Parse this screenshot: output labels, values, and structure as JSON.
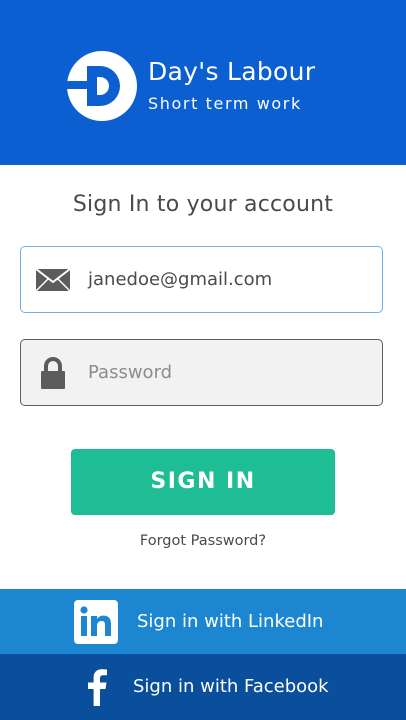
{
  "brand": {
    "name": "Day's Labour",
    "tagline": "Short term work",
    "color": "#0b5fd1"
  },
  "signin": {
    "title": "Sign In to your account",
    "email_value": "janedoe@gmail.com",
    "password_placeholder": "Password",
    "button_label": "SIGN IN",
    "forgot_label": "Forgot Password?",
    "button_color": "#1ebd96"
  },
  "social": {
    "linkedin_label": "Sign in with LinkedIn",
    "facebook_label": "Sign in with Facebook",
    "linkedin_color": "#1c86d1",
    "facebook_color": "#0a4f9c"
  },
  "icons": {
    "email": "envelope-icon",
    "password": "lock-icon",
    "linkedin": "linkedin-icon",
    "facebook": "facebook-icon",
    "logo": "days-labour-logo"
  }
}
